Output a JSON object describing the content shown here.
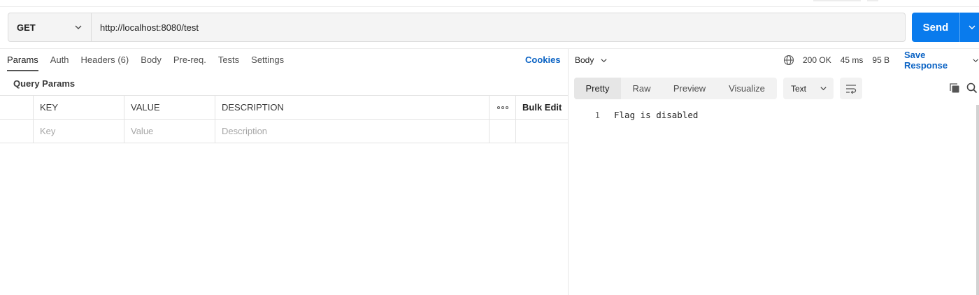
{
  "request": {
    "method": "GET",
    "url": "http://localhost:8080/test",
    "send_label": "Send"
  },
  "request_tabs": [
    {
      "label": "Params",
      "active": true
    },
    {
      "label": "Auth"
    },
    {
      "label": "Headers",
      "count": "(6)"
    },
    {
      "label": "Body"
    },
    {
      "label": "Pre-req."
    },
    {
      "label": "Tests"
    },
    {
      "label": "Settings"
    }
  ],
  "cookies_label": "Cookies",
  "query_params": {
    "title": "Query Params",
    "headers": [
      "KEY",
      "VALUE",
      "DESCRIPTION"
    ],
    "bulk_edit": "Bulk Edit",
    "placeholders": {
      "key": "Key",
      "value": "Value",
      "description": "Description"
    }
  },
  "response": {
    "section_label": "Body",
    "status": "200 OK",
    "time": "45 ms",
    "size": "95 B",
    "save_label": "Save Response",
    "view_tabs": [
      "Pretty",
      "Raw",
      "Preview",
      "Visualize"
    ],
    "active_view": "Pretty",
    "format": "Text",
    "lines": [
      {
        "number": "1",
        "text": "Flag is disabled"
      }
    ]
  },
  "icons": [
    "chevron-down-icon",
    "globe-icon",
    "wrap-lines-icon",
    "copy-icon",
    "search-icon",
    "more-options-icon"
  ],
  "colors": {
    "primary": "#097bed",
    "link": "#0b63c4"
  }
}
